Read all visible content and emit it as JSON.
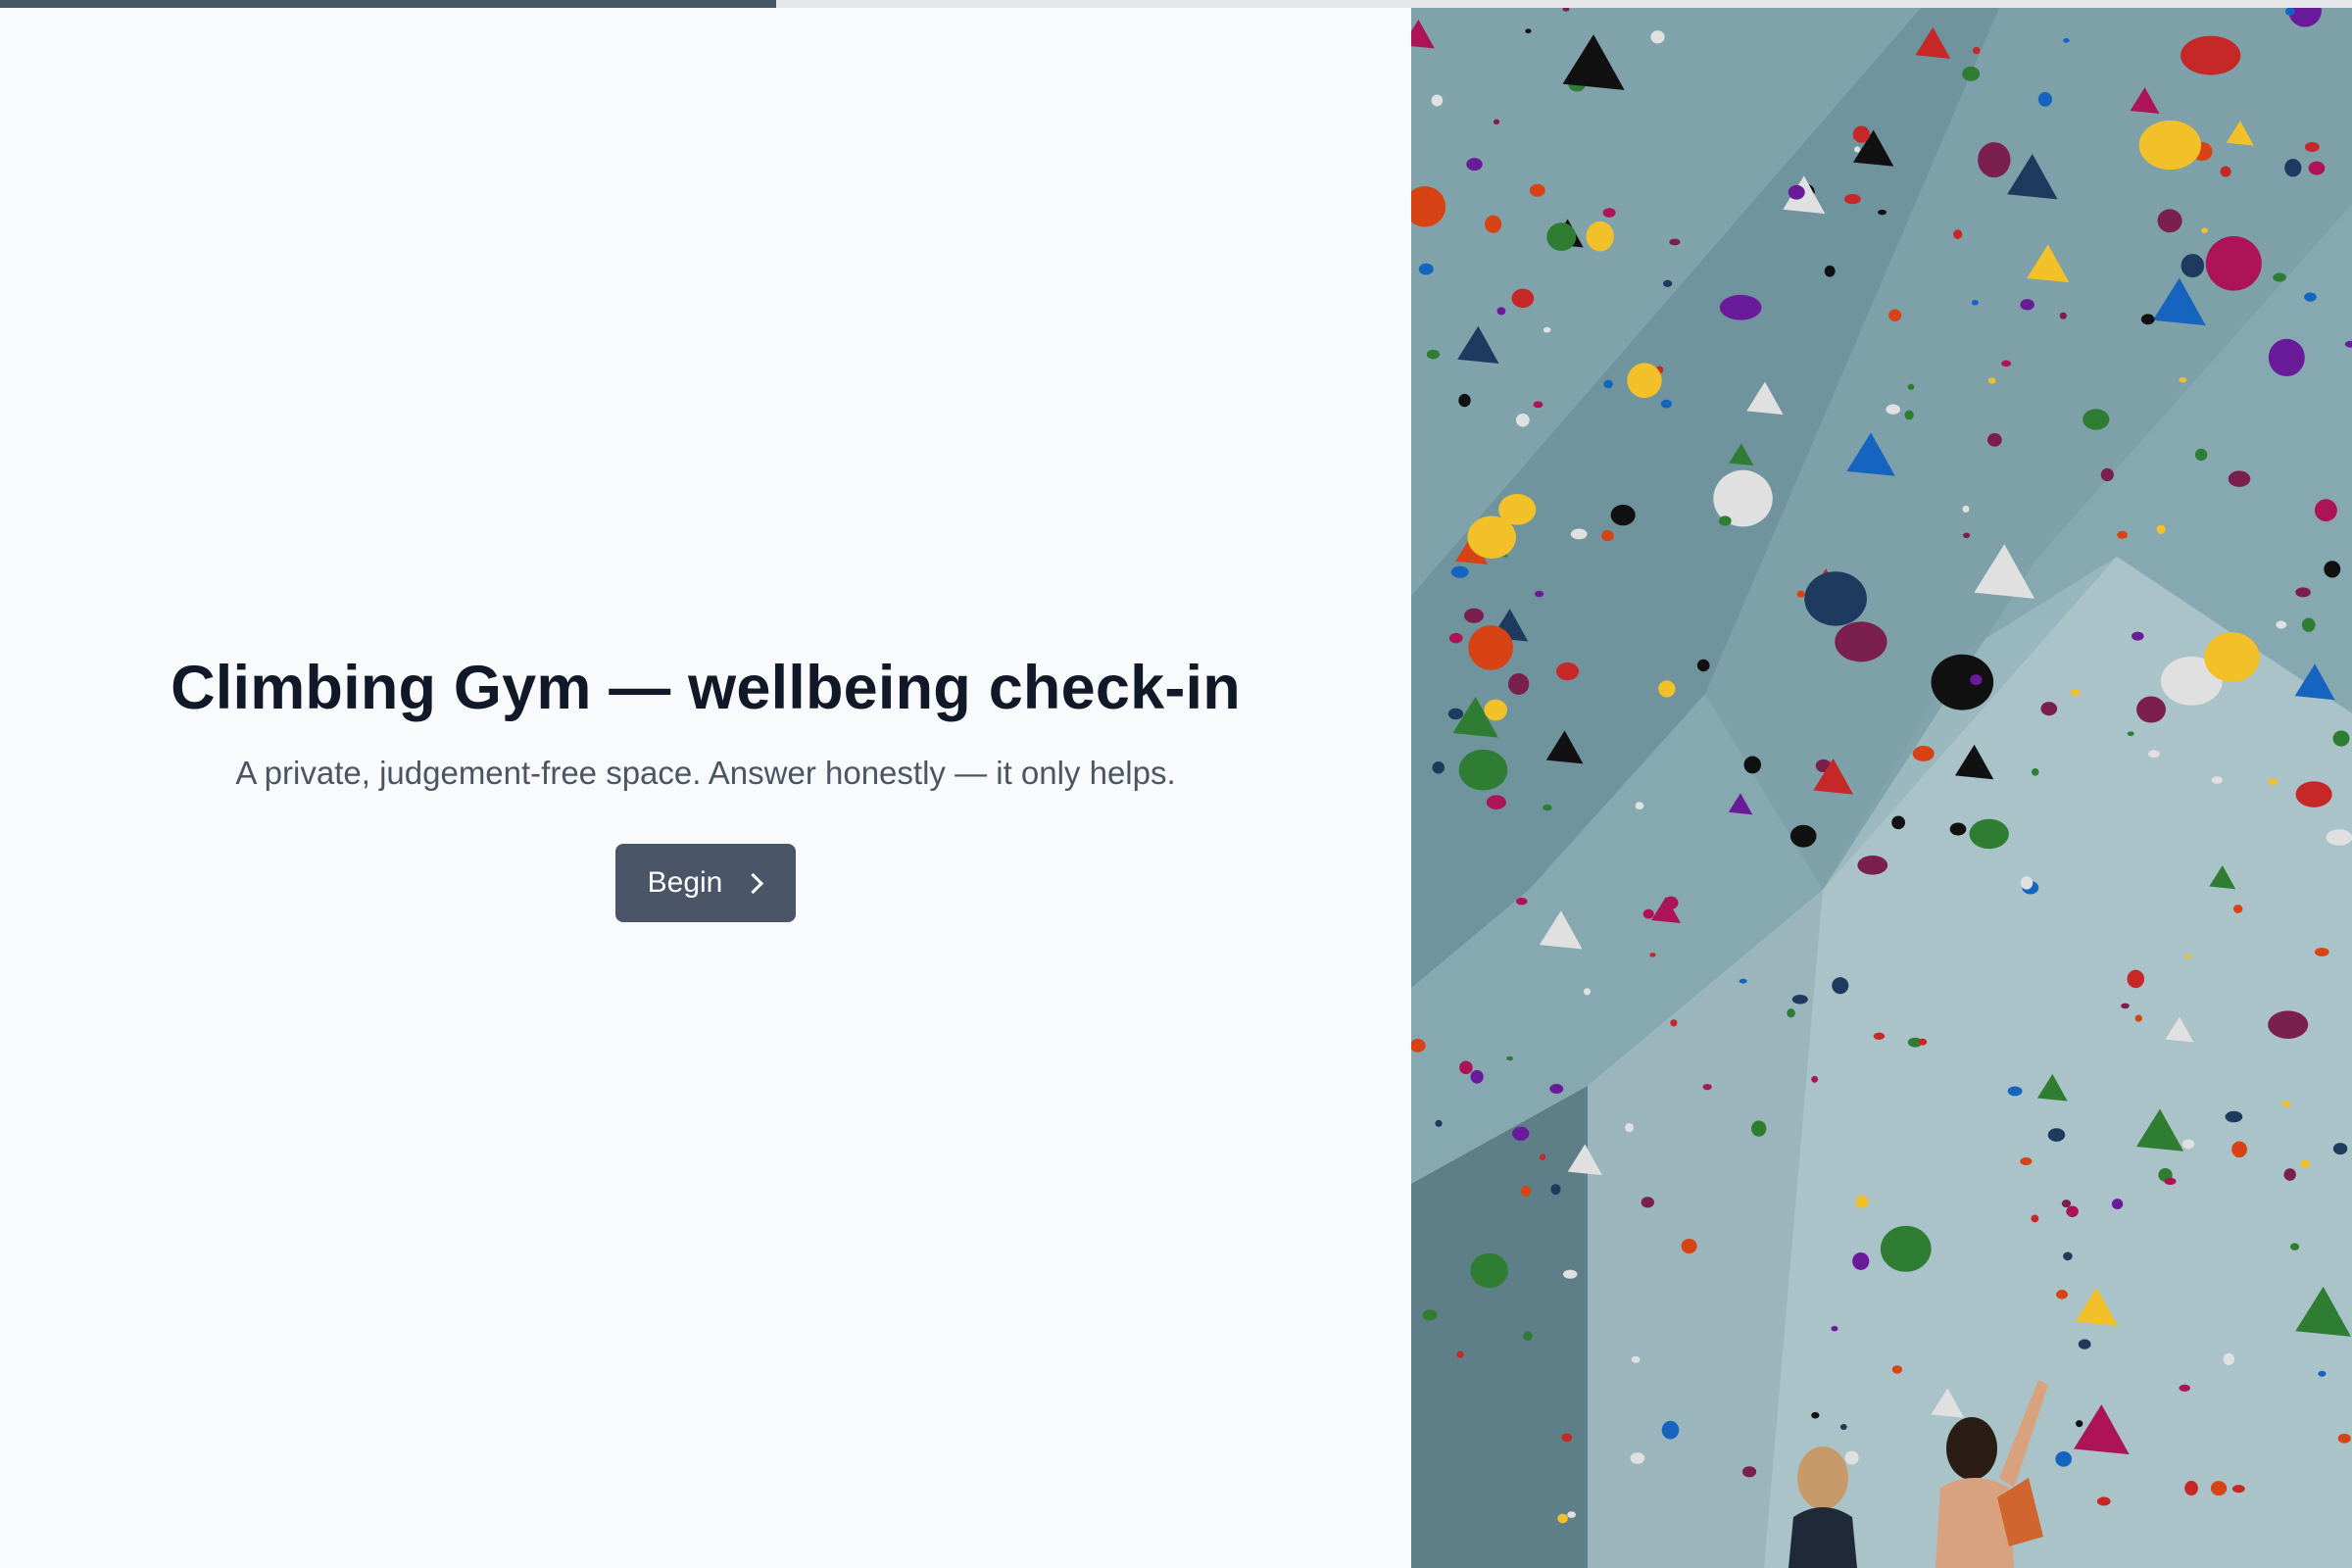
{
  "progress": {
    "fraction": 0.33,
    "fill_color": "#475569",
    "track_color": "#e5e7eb"
  },
  "intro": {
    "title": "Climbing Gym — wellbeing check-in",
    "subtitle": "A private, judgement-free space. Answer honestly — it only helps.",
    "begin_label": "Begin",
    "begin_icon": "chevron-right-icon"
  },
  "photo": {
    "subject": "climbing-wall-photo"
  },
  "colors": {
    "button": "#4a5568",
    "title": "#111827",
    "subtitle": "#4b5563",
    "background": "#f9fafb"
  }
}
